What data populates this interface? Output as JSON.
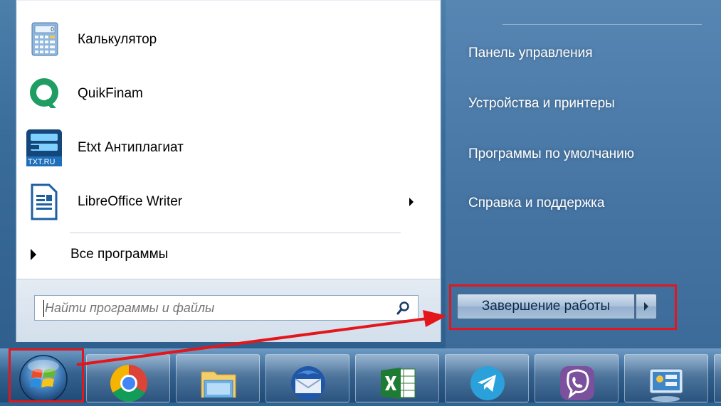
{
  "left_pane": {
    "programs": [
      {
        "label": "Калькулятор",
        "icon": "calculator-icon",
        "has_submenu": false
      },
      {
        "label": "QuikFinam",
        "icon": "quikfinam-icon",
        "has_submenu": false
      },
      {
        "label": "Etxt Антиплагиат",
        "icon": "etxt-icon",
        "has_submenu": false
      },
      {
        "label": "LibreOffice Writer",
        "icon": "libreoffice-writer-icon",
        "has_submenu": true
      }
    ],
    "etxt_badge": "TXT.RU",
    "all_programs": "Все программы",
    "search": {
      "placeholder": "Найти программы и файлы"
    }
  },
  "right_pane": {
    "links": [
      "Панель управления",
      "Устройства и принтеры",
      "Программы по умолчанию",
      "Справка и поддержка"
    ],
    "shutdown_label": "Завершение работы"
  },
  "taskbar": {
    "items": [
      "chrome-icon",
      "explorer-folder-icon",
      "thunderbird-icon",
      "excel-icon",
      "telegram-icon",
      "viber-icon",
      "control-panel-icon"
    ]
  },
  "colors": {
    "highlight": "#e3161b",
    "taskbar": "#2a5888",
    "accent_blue": "#3d6b99"
  }
}
